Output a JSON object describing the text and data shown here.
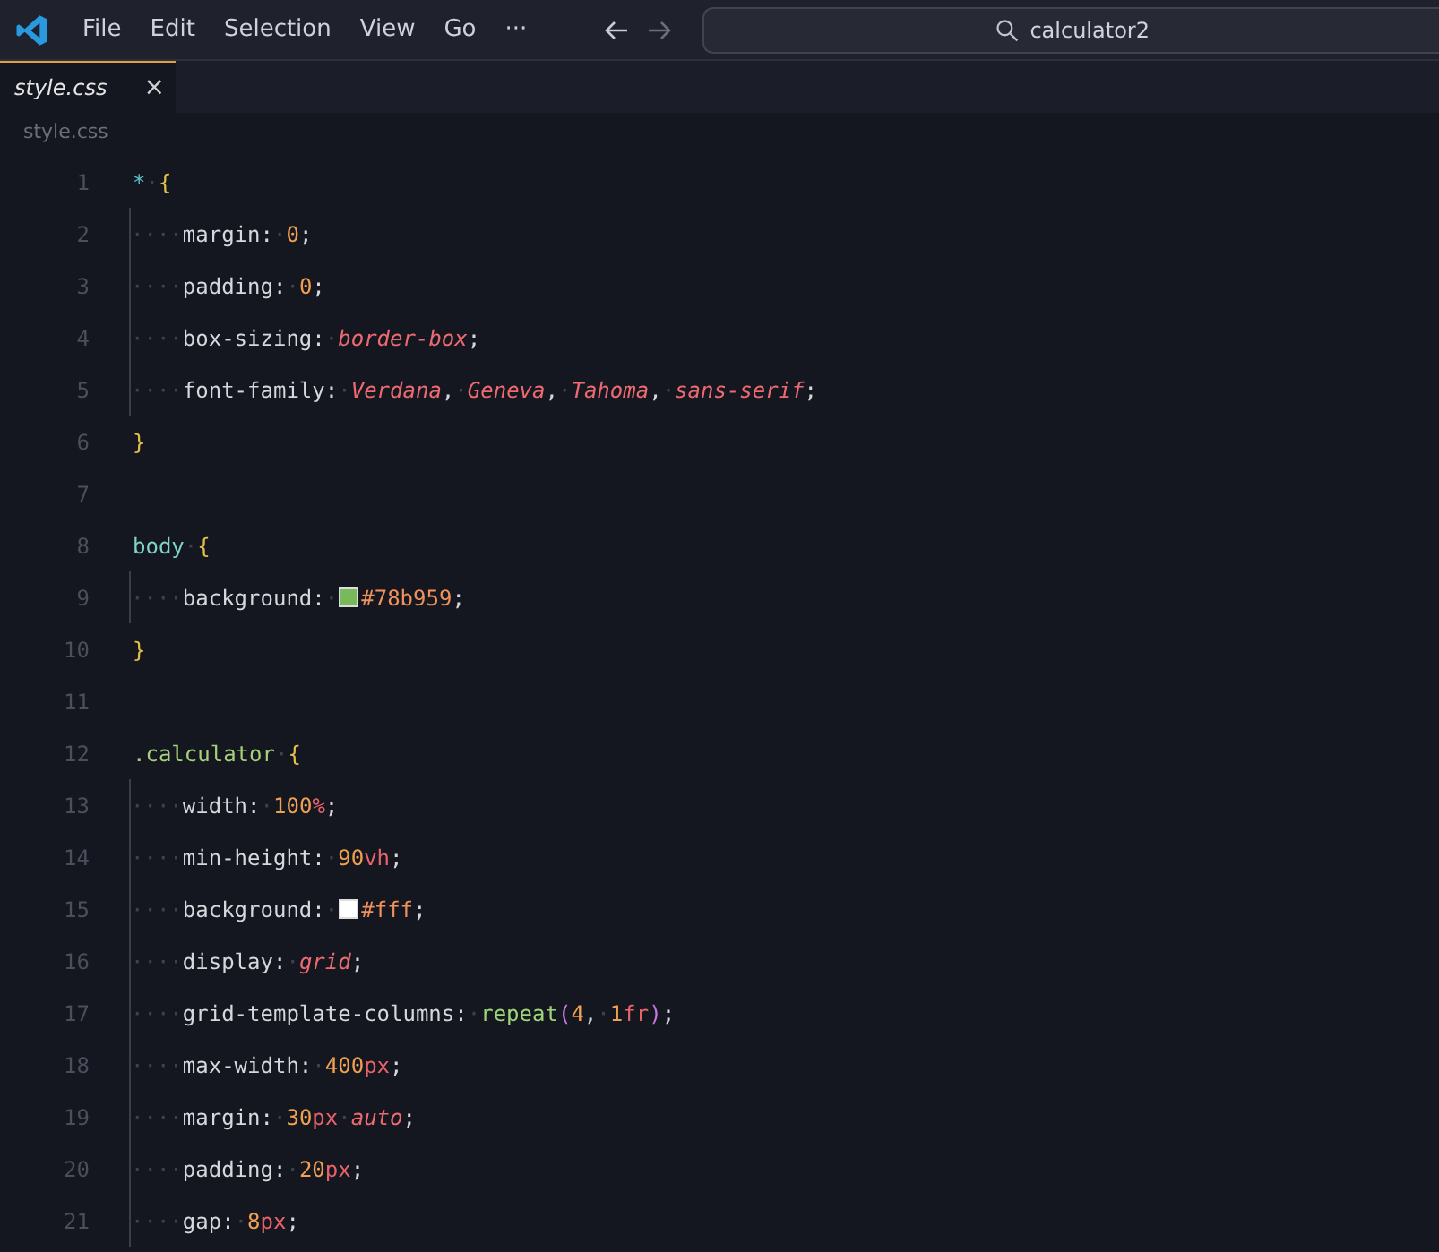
{
  "menu": [
    "File",
    "Edit",
    "Selection",
    "View",
    "Go",
    "···"
  ],
  "search": {
    "value": "calculator2"
  },
  "tabs": [
    {
      "label": "style.css",
      "selected": true,
      "close": "×"
    }
  ],
  "breadcrumb": "style.css",
  "lines": [
    {
      "number": "1",
      "guide": false,
      "tokens": [
        {
          "kind": "sel-universal",
          "text": "*"
        },
        {
          "kind": "ws",
          "text": "·"
        },
        {
          "kind": "brace",
          "text": "{"
        }
      ]
    },
    {
      "number": "2",
      "guide": true,
      "tokens": [
        {
          "kind": "ws",
          "text": "····"
        },
        {
          "kind": "prop",
          "text": "margin:"
        },
        {
          "kind": "ws",
          "text": "·"
        },
        {
          "kind": "num",
          "text": "0"
        },
        {
          "kind": "punct",
          "text": ";"
        }
      ]
    },
    {
      "number": "3",
      "guide": true,
      "tokens": [
        {
          "kind": "ws",
          "text": "····"
        },
        {
          "kind": "prop",
          "text": "padding:"
        },
        {
          "kind": "ws",
          "text": "·"
        },
        {
          "kind": "num",
          "text": "0"
        },
        {
          "kind": "punct",
          "text": ";"
        }
      ]
    },
    {
      "number": "4",
      "guide": true,
      "tokens": [
        {
          "kind": "ws",
          "text": "····"
        },
        {
          "kind": "prop",
          "text": "box-sizing:"
        },
        {
          "kind": "ws",
          "text": "·"
        },
        {
          "kind": "kw",
          "text": "border-box"
        },
        {
          "kind": "punct",
          "text": ";"
        }
      ]
    },
    {
      "number": "5",
      "guide": true,
      "tokens": [
        {
          "kind": "ws",
          "text": "····"
        },
        {
          "kind": "prop",
          "text": "font-family:"
        },
        {
          "kind": "ws",
          "text": "·"
        },
        {
          "kind": "kw",
          "text": "Verdana"
        },
        {
          "kind": "punct",
          "text": ","
        },
        {
          "kind": "ws",
          "text": "·"
        },
        {
          "kind": "kw",
          "text": "Geneva"
        },
        {
          "kind": "punct",
          "text": ","
        },
        {
          "kind": "ws",
          "text": "·"
        },
        {
          "kind": "kw",
          "text": "Tahoma"
        },
        {
          "kind": "punct",
          "text": ","
        },
        {
          "kind": "ws",
          "text": "·"
        },
        {
          "kind": "kw",
          "text": "sans-serif"
        },
        {
          "kind": "punct",
          "text": ";"
        }
      ]
    },
    {
      "number": "6",
      "guide": false,
      "tokens": [
        {
          "kind": "brace",
          "text": "}"
        }
      ]
    },
    {
      "number": "7",
      "guide": false
    },
    {
      "number": "8",
      "guide": false,
      "tokens": [
        {
          "kind": "sel-tag",
          "text": "body"
        },
        {
          "kind": "ws",
          "text": "·"
        },
        {
          "kind": "brace",
          "text": "{"
        }
      ]
    },
    {
      "number": "9",
      "guide": true,
      "tokens": [
        {
          "kind": "ws",
          "text": "····"
        },
        {
          "kind": "prop",
          "text": "background:"
        },
        {
          "kind": "ws",
          "text": "·"
        },
        {
          "kind": "swatch",
          "color": "#78b959"
        },
        {
          "kind": "hex",
          "text": "#78b959"
        },
        {
          "kind": "punct",
          "text": ";"
        }
      ]
    },
    {
      "number": "10",
      "guide": false,
      "tokens": [
        {
          "kind": "brace",
          "text": "}"
        }
      ]
    },
    {
      "number": "11",
      "guide": false
    },
    {
      "number": "12",
      "guide": false,
      "tokens": [
        {
          "kind": "sel-class",
          "text": ".calculator"
        },
        {
          "kind": "ws",
          "text": "·"
        },
        {
          "kind": "brace",
          "text": "{"
        }
      ]
    },
    {
      "number": "13",
      "guide": true,
      "tokens": [
        {
          "kind": "ws",
          "text": "····"
        },
        {
          "kind": "prop",
          "text": "width:"
        },
        {
          "kind": "ws",
          "text": "·"
        },
        {
          "kind": "num",
          "text": "100"
        },
        {
          "kind": "unit",
          "text": "%"
        },
        {
          "kind": "punct",
          "text": ";"
        }
      ]
    },
    {
      "number": "14",
      "guide": true,
      "tokens": [
        {
          "kind": "ws",
          "text": "····"
        },
        {
          "kind": "prop",
          "text": "min-height:"
        },
        {
          "kind": "ws",
          "text": "·"
        },
        {
          "kind": "num",
          "text": "90"
        },
        {
          "kind": "unit",
          "text": "vh"
        },
        {
          "kind": "punct",
          "text": ";"
        }
      ]
    },
    {
      "number": "15",
      "guide": true,
      "tokens": [
        {
          "kind": "ws",
          "text": "····"
        },
        {
          "kind": "prop",
          "text": "background:"
        },
        {
          "kind": "ws",
          "text": "·"
        },
        {
          "kind": "swatch",
          "color": "#ffffff"
        },
        {
          "kind": "hex",
          "text": "#fff"
        },
        {
          "kind": "punct",
          "text": ";"
        }
      ]
    },
    {
      "number": "16",
      "guide": true,
      "tokens": [
        {
          "kind": "ws",
          "text": "····"
        },
        {
          "kind": "prop",
          "text": "display:"
        },
        {
          "kind": "ws",
          "text": "·"
        },
        {
          "kind": "kw",
          "text": "grid"
        },
        {
          "kind": "punct",
          "text": ";"
        }
      ]
    },
    {
      "number": "17",
      "guide": true,
      "tokens": [
        {
          "kind": "ws",
          "text": "····"
        },
        {
          "kind": "prop",
          "text": "grid-template-columns:"
        },
        {
          "kind": "ws",
          "text": "·"
        },
        {
          "kind": "fn",
          "text": "repeat"
        },
        {
          "kind": "paren",
          "text": "("
        },
        {
          "kind": "num",
          "text": "4"
        },
        {
          "kind": "punct",
          "text": ","
        },
        {
          "kind": "ws",
          "text": "·"
        },
        {
          "kind": "num",
          "text": "1"
        },
        {
          "kind": "unit",
          "text": "fr"
        },
        {
          "kind": "paren",
          "text": ")"
        },
        {
          "kind": "punct",
          "text": ";"
        }
      ]
    },
    {
      "number": "18",
      "guide": true,
      "tokens": [
        {
          "kind": "ws",
          "text": "····"
        },
        {
          "kind": "prop",
          "text": "max-width:"
        },
        {
          "kind": "ws",
          "text": "·"
        },
        {
          "kind": "num",
          "text": "400"
        },
        {
          "kind": "unit",
          "text": "px"
        },
        {
          "kind": "punct",
          "text": ";"
        }
      ]
    },
    {
      "number": "19",
      "guide": true,
      "tokens": [
        {
          "kind": "ws",
          "text": "····"
        },
        {
          "kind": "prop",
          "text": "margin:"
        },
        {
          "kind": "ws",
          "text": "·"
        },
        {
          "kind": "num",
          "text": "30"
        },
        {
          "kind": "unit",
          "text": "px"
        },
        {
          "kind": "ws",
          "text": "·"
        },
        {
          "kind": "kw",
          "text": "auto"
        },
        {
          "kind": "punct",
          "text": ";"
        }
      ]
    },
    {
      "number": "20",
      "guide": true,
      "tokens": [
        {
          "kind": "ws",
          "text": "····"
        },
        {
          "kind": "prop",
          "text": "padding:"
        },
        {
          "kind": "ws",
          "text": "·"
        },
        {
          "kind": "num",
          "text": "20"
        },
        {
          "kind": "unit",
          "text": "px"
        },
        {
          "kind": "punct",
          "text": ";"
        }
      ]
    },
    {
      "number": "21",
      "guide": true,
      "tokens": [
        {
          "kind": "ws",
          "text": "····"
        },
        {
          "kind": "prop",
          "text": "gap:"
        },
        {
          "kind": "ws",
          "text": "·"
        },
        {
          "kind": "num",
          "text": "8"
        },
        {
          "kind": "unit",
          "text": "px"
        },
        {
          "kind": "punct",
          "text": ";"
        }
      ]
    }
  ]
}
